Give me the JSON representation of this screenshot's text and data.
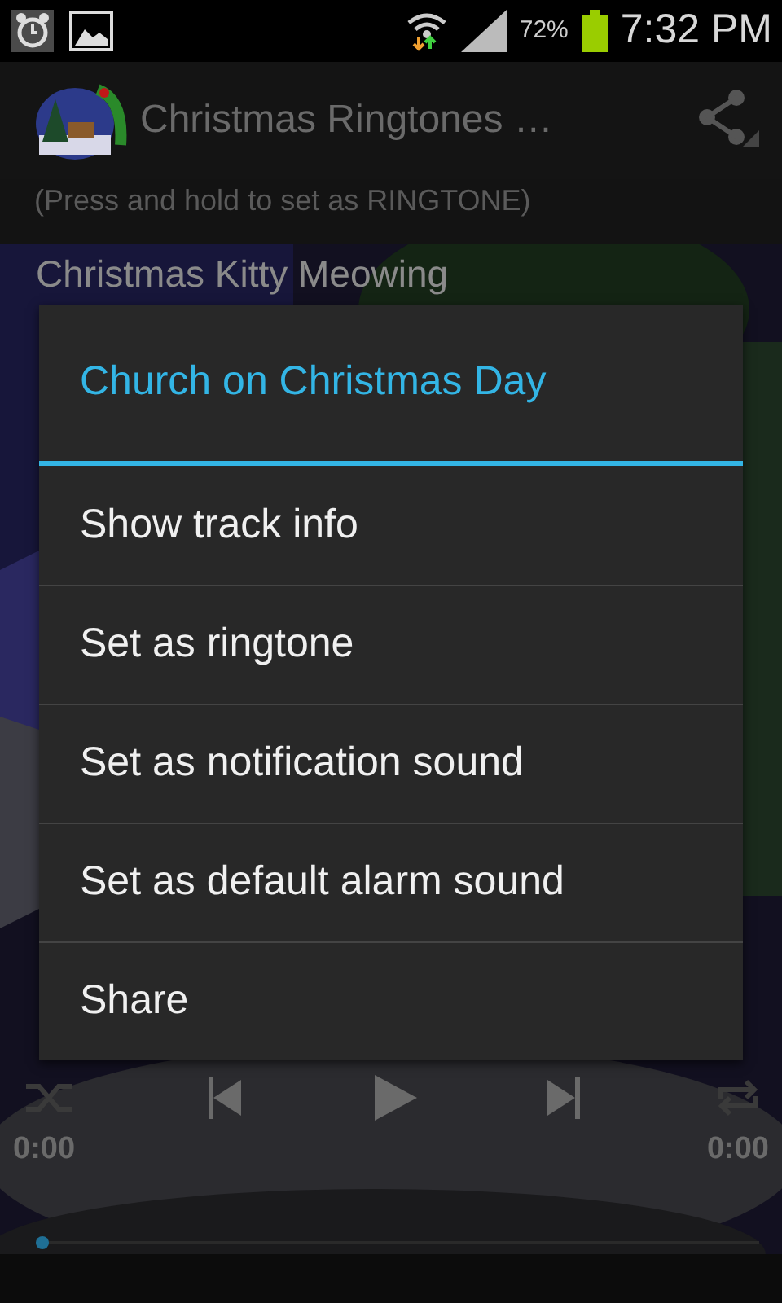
{
  "status_bar": {
    "battery": "72%",
    "time": "7:32 PM"
  },
  "app_bar": {
    "title": "Christmas Ringtones …",
    "subtitle": "(Press and hold to set as RINGTONE)"
  },
  "list": [
    {
      "title": "Christmas Kitty Meowing"
    }
  ],
  "player": {
    "level": 0,
    "elapsed": "0:00",
    "duration": "0:00"
  },
  "dialog": {
    "title": "Church on Christmas Day",
    "items": [
      {
        "label": "Show track info"
      },
      {
        "label": "Set as ringtone"
      },
      {
        "label": "Set as notification sound"
      },
      {
        "label": "Set as default alarm sound"
      },
      {
        "label": "Share"
      }
    ]
  }
}
